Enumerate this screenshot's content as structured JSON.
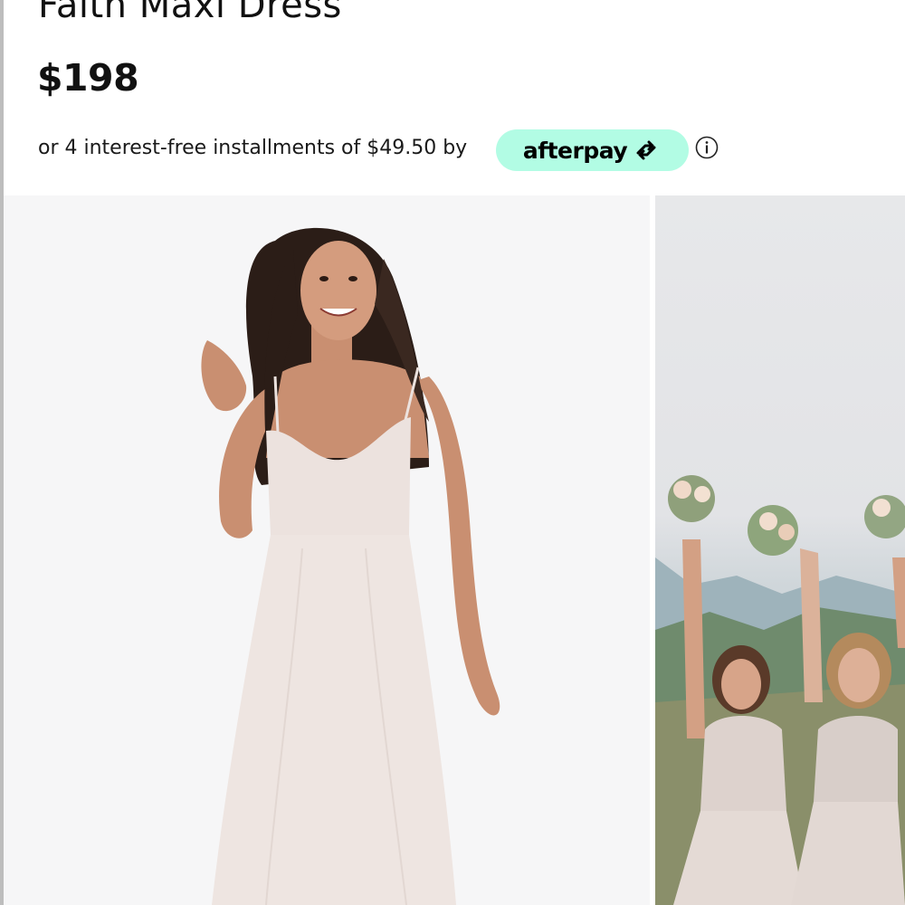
{
  "product": {
    "title": "Faith Maxi Dress",
    "price": "$198"
  },
  "payment": {
    "installments_text": "or 4 interest-free installments of $49.50 by",
    "provider_label": "afterpay",
    "provider_color": "#b2fce4",
    "info_icon": "info-icon"
  },
  "gallery": {
    "images": [
      {
        "name": "main-product-image",
        "alt": ""
      },
      {
        "name": "secondary-product-image",
        "alt": ""
      }
    ]
  }
}
